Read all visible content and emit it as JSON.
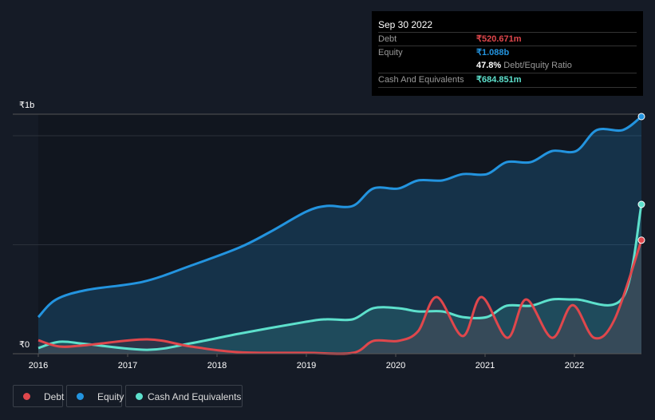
{
  "tooltip": {
    "date": "Sep 30 2022",
    "debt_label": "Debt",
    "debt_value": "₹520.671m",
    "equity_label": "Equity",
    "equity_value": "₹1.088b",
    "ratio_value": "47.8%",
    "ratio_label": "Debt/Equity Ratio",
    "cash_label": "Cash And Equivalents",
    "cash_value": "₹684.851m"
  },
  "legend": {
    "debt": "Debt",
    "equity": "Equity",
    "cash": "Cash And Equivalents"
  },
  "chart_data": {
    "type": "area",
    "x_unit": "year",
    "y_unit": "₹ billions",
    "ylim": [
      0,
      1.1
    ],
    "y_ticks": [
      {
        "v": 0,
        "label": "₹0"
      },
      {
        "v": 1,
        "label": "₹1b"
      }
    ],
    "x_ticks": [
      2016,
      2017,
      2018,
      2019,
      2020,
      2021,
      2022
    ],
    "colors": {
      "debt": "#e0474c",
      "equity": "#2394df",
      "cash": "#5de0cc"
    },
    "series": [
      {
        "name": "Equity",
        "key": "equity",
        "points": [
          [
            2016,
            0.168
          ],
          [
            2016.2,
            0.249
          ],
          [
            2016.55,
            0.293
          ],
          [
            2017.17,
            0.33
          ],
          [
            2017.7,
            0.403
          ],
          [
            2018.25,
            0.487
          ],
          [
            2018.6,
            0.56
          ],
          [
            2019,
            0.652
          ],
          [
            2019.23,
            0.678
          ],
          [
            2019.52,
            0.678
          ],
          [
            2019.75,
            0.758
          ],
          [
            2020.03,
            0.758
          ],
          [
            2020.25,
            0.795
          ],
          [
            2020.52,
            0.795
          ],
          [
            2020.75,
            0.824
          ],
          [
            2021.02,
            0.824
          ],
          [
            2021.24,
            0.879
          ],
          [
            2021.51,
            0.879
          ],
          [
            2021.75,
            0.93
          ],
          [
            2022.02,
            0.93
          ],
          [
            2022.25,
            1.026
          ],
          [
            2022.54,
            1.026
          ],
          [
            2022.75,
            1.088
          ]
        ]
      },
      {
        "name": "Cash And Equivalents",
        "key": "cash",
        "points": [
          [
            2016,
            0.026
          ],
          [
            2016.24,
            0.055
          ],
          [
            2016.55,
            0.044
          ],
          [
            2017.22,
            0.018
          ],
          [
            2017.71,
            0.048
          ],
          [
            2018.25,
            0.092
          ],
          [
            2019,
            0.147
          ],
          [
            2019.23,
            0.158
          ],
          [
            2019.52,
            0.158
          ],
          [
            2019.75,
            0.209
          ],
          [
            2020.03,
            0.209
          ],
          [
            2020.25,
            0.194
          ],
          [
            2020.52,
            0.194
          ],
          [
            2020.75,
            0.168
          ],
          [
            2021.02,
            0.168
          ],
          [
            2021.24,
            0.22
          ],
          [
            2021.51,
            0.22
          ],
          [
            2021.75,
            0.249
          ],
          [
            2022.02,
            0.249
          ],
          [
            2022.54,
            0.256
          ],
          [
            2022.75,
            0.685
          ]
        ]
      },
      {
        "name": "Debt",
        "key": "debt",
        "points": [
          [
            2016,
            0.062
          ],
          [
            2016.24,
            0.033
          ],
          [
            2016.55,
            0.04
          ],
          [
            2017.22,
            0.066
          ],
          [
            2017.71,
            0.033
          ],
          [
            2018.25,
            0.007
          ],
          [
            2019,
            0.004
          ],
          [
            2019.52,
            0.004
          ],
          [
            2019.75,
            0.059
          ],
          [
            2020.03,
            0.059
          ],
          [
            2020.25,
            0.103
          ],
          [
            2020.46,
            0.26
          ],
          [
            2020.75,
            0.081
          ],
          [
            2020.96,
            0.26
          ],
          [
            2021.25,
            0.073
          ],
          [
            2021.46,
            0.249
          ],
          [
            2021.75,
            0.073
          ],
          [
            2021.98,
            0.223
          ],
          [
            2022.22,
            0.073
          ],
          [
            2022.45,
            0.158
          ],
          [
            2022.75,
            0.521
          ]
        ]
      }
    ]
  }
}
